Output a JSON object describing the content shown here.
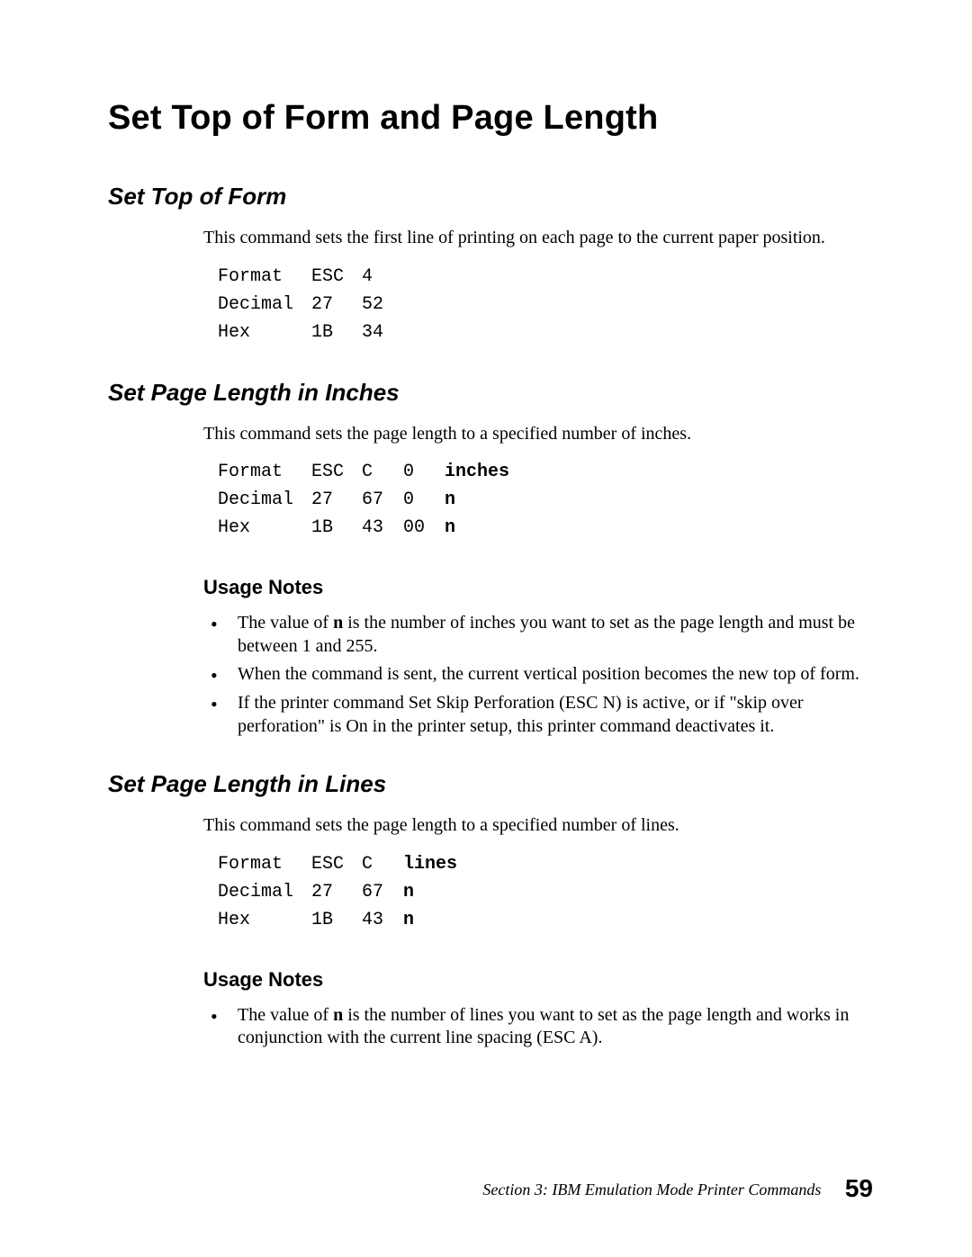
{
  "title": "Set Top of Form and Page Length",
  "footer_section": "Section 3: IBM Emulation Mode Printer Commands",
  "page_number": "59",
  "sections": {
    "stof": {
      "heading": "Set Top of Form",
      "para": "This command sets the first line of printing on each page to the current paper position.",
      "table": {
        "r0": {
          "c0": "Format",
          "c1": "ESC",
          "c2": "4"
        },
        "r1": {
          "c0": "Decimal",
          "c1": "27",
          "c2": "52"
        },
        "r2": {
          "c0": "Hex",
          "c1": "1B",
          "c2": "34"
        }
      }
    },
    "spli": {
      "heading": "Set Page Length in Inches",
      "para": "This command sets the page length to a specified number of inches.",
      "table": {
        "r0": {
          "c0": "Format",
          "c1": "ESC",
          "c2": "C",
          "c3": "0",
          "c4": "inches"
        },
        "r1": {
          "c0": "Decimal",
          "c1": "27",
          "c2": "67",
          "c3": "0",
          "c4": "n"
        },
        "r2": {
          "c0": "Hex",
          "c1": "1B",
          "c2": "43",
          "c3": "00",
          "c4": "n"
        }
      },
      "usage_heading": "Usage Notes",
      "bullets": {
        "b0a": "The value of ",
        "b0n": "n",
        "b0b": " is the number of inches you want to set as the page length and must be between 1 and 255.",
        "b1": "When the command is sent, the current vertical position becomes the new top of form.",
        "b2": "If the printer command Set Skip Perforation (ESC N) is active, or if \"skip over perforation\" is On in the printer setup, this printer command deactivates it."
      }
    },
    "spll": {
      "heading": "Set Page Length in Lines",
      "para": "This command sets the page length to a specified number of lines.",
      "table": {
        "r0": {
          "c0": "Format",
          "c1": "ESC",
          "c2": "C",
          "c3": "lines"
        },
        "r1": {
          "c0": "Decimal",
          "c1": "27",
          "c2": "67",
          "c3": "n"
        },
        "r2": {
          "c0": "Hex",
          "c1": "1B",
          "c2": "43",
          "c3": "n"
        }
      },
      "usage_heading": "Usage Notes",
      "bullets": {
        "b0a": "The value of ",
        "b0n": "n",
        "b0b": " is the number of lines you want to set as the page length and works in conjunction with the current line spacing (ESC A)."
      }
    }
  }
}
